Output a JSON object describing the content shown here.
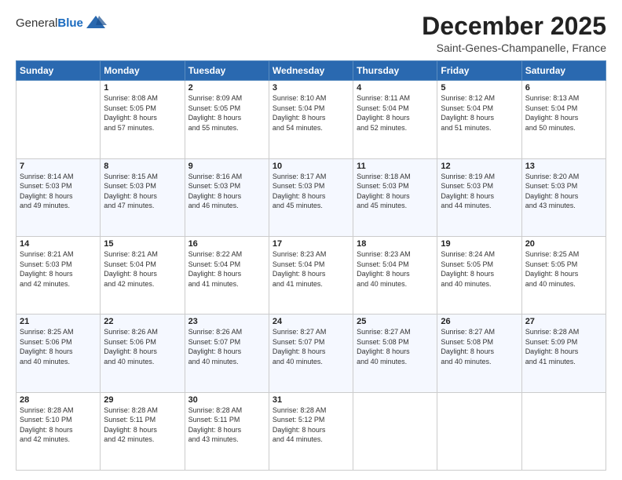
{
  "logo": {
    "general": "General",
    "blue": "Blue"
  },
  "title": "December 2025",
  "subtitle": "Saint-Genes-Champanelle, France",
  "days_header": [
    "Sunday",
    "Monday",
    "Tuesday",
    "Wednesday",
    "Thursday",
    "Friday",
    "Saturday"
  ],
  "weeks": [
    [
      {
        "day": "",
        "info": ""
      },
      {
        "day": "1",
        "info": "Sunrise: 8:08 AM\nSunset: 5:05 PM\nDaylight: 8 hours\nand 57 minutes."
      },
      {
        "day": "2",
        "info": "Sunrise: 8:09 AM\nSunset: 5:05 PM\nDaylight: 8 hours\nand 55 minutes."
      },
      {
        "day": "3",
        "info": "Sunrise: 8:10 AM\nSunset: 5:04 PM\nDaylight: 8 hours\nand 54 minutes."
      },
      {
        "day": "4",
        "info": "Sunrise: 8:11 AM\nSunset: 5:04 PM\nDaylight: 8 hours\nand 52 minutes."
      },
      {
        "day": "5",
        "info": "Sunrise: 8:12 AM\nSunset: 5:04 PM\nDaylight: 8 hours\nand 51 minutes."
      },
      {
        "day": "6",
        "info": "Sunrise: 8:13 AM\nSunset: 5:04 PM\nDaylight: 8 hours\nand 50 minutes."
      }
    ],
    [
      {
        "day": "7",
        "info": "Sunrise: 8:14 AM\nSunset: 5:03 PM\nDaylight: 8 hours\nand 49 minutes."
      },
      {
        "day": "8",
        "info": "Sunrise: 8:15 AM\nSunset: 5:03 PM\nDaylight: 8 hours\nand 47 minutes."
      },
      {
        "day": "9",
        "info": "Sunrise: 8:16 AM\nSunset: 5:03 PM\nDaylight: 8 hours\nand 46 minutes."
      },
      {
        "day": "10",
        "info": "Sunrise: 8:17 AM\nSunset: 5:03 PM\nDaylight: 8 hours\nand 45 minutes."
      },
      {
        "day": "11",
        "info": "Sunrise: 8:18 AM\nSunset: 5:03 PM\nDaylight: 8 hours\nand 45 minutes."
      },
      {
        "day": "12",
        "info": "Sunrise: 8:19 AM\nSunset: 5:03 PM\nDaylight: 8 hours\nand 44 minutes."
      },
      {
        "day": "13",
        "info": "Sunrise: 8:20 AM\nSunset: 5:03 PM\nDaylight: 8 hours\nand 43 minutes."
      }
    ],
    [
      {
        "day": "14",
        "info": "Sunrise: 8:21 AM\nSunset: 5:03 PM\nDaylight: 8 hours\nand 42 minutes."
      },
      {
        "day": "15",
        "info": "Sunrise: 8:21 AM\nSunset: 5:04 PM\nDaylight: 8 hours\nand 42 minutes."
      },
      {
        "day": "16",
        "info": "Sunrise: 8:22 AM\nSunset: 5:04 PM\nDaylight: 8 hours\nand 41 minutes."
      },
      {
        "day": "17",
        "info": "Sunrise: 8:23 AM\nSunset: 5:04 PM\nDaylight: 8 hours\nand 41 minutes."
      },
      {
        "day": "18",
        "info": "Sunrise: 8:23 AM\nSunset: 5:04 PM\nDaylight: 8 hours\nand 40 minutes."
      },
      {
        "day": "19",
        "info": "Sunrise: 8:24 AM\nSunset: 5:05 PM\nDaylight: 8 hours\nand 40 minutes."
      },
      {
        "day": "20",
        "info": "Sunrise: 8:25 AM\nSunset: 5:05 PM\nDaylight: 8 hours\nand 40 minutes."
      }
    ],
    [
      {
        "day": "21",
        "info": "Sunrise: 8:25 AM\nSunset: 5:06 PM\nDaylight: 8 hours\nand 40 minutes."
      },
      {
        "day": "22",
        "info": "Sunrise: 8:26 AM\nSunset: 5:06 PM\nDaylight: 8 hours\nand 40 minutes."
      },
      {
        "day": "23",
        "info": "Sunrise: 8:26 AM\nSunset: 5:07 PM\nDaylight: 8 hours\nand 40 minutes."
      },
      {
        "day": "24",
        "info": "Sunrise: 8:27 AM\nSunset: 5:07 PM\nDaylight: 8 hours\nand 40 minutes."
      },
      {
        "day": "25",
        "info": "Sunrise: 8:27 AM\nSunset: 5:08 PM\nDaylight: 8 hours\nand 40 minutes."
      },
      {
        "day": "26",
        "info": "Sunrise: 8:27 AM\nSunset: 5:08 PM\nDaylight: 8 hours\nand 40 minutes."
      },
      {
        "day": "27",
        "info": "Sunrise: 8:28 AM\nSunset: 5:09 PM\nDaylight: 8 hours\nand 41 minutes."
      }
    ],
    [
      {
        "day": "28",
        "info": "Sunrise: 8:28 AM\nSunset: 5:10 PM\nDaylight: 8 hours\nand 42 minutes."
      },
      {
        "day": "29",
        "info": "Sunrise: 8:28 AM\nSunset: 5:11 PM\nDaylight: 8 hours\nand 42 minutes."
      },
      {
        "day": "30",
        "info": "Sunrise: 8:28 AM\nSunset: 5:11 PM\nDaylight: 8 hours\nand 43 minutes."
      },
      {
        "day": "31",
        "info": "Sunrise: 8:28 AM\nSunset: 5:12 PM\nDaylight: 8 hours\nand 44 minutes."
      },
      {
        "day": "",
        "info": ""
      },
      {
        "day": "",
        "info": ""
      },
      {
        "day": "",
        "info": ""
      }
    ]
  ]
}
